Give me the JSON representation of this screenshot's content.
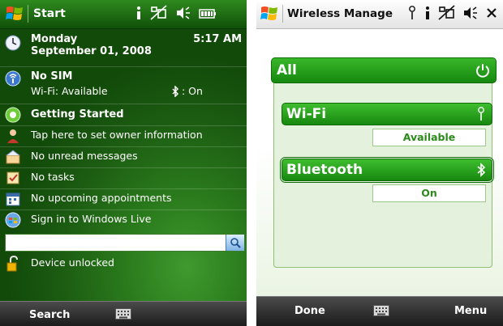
{
  "left_screen": {
    "titlebar": {
      "title": "Start"
    },
    "date_block": {
      "day": "Monday",
      "date": "September 01, 2008",
      "time": "5:17 AM"
    },
    "sim_block": {
      "title": "No SIM",
      "wifi": "Wi-Fi: Available",
      "bluetooth": ": On"
    },
    "items": [
      {
        "label": "Getting Started",
        "icon": "getting-started-icon"
      },
      {
        "label": "Tap here to set owner information",
        "icon": "owner-icon"
      },
      {
        "label": "No unread messages",
        "icon": "messages-icon"
      },
      {
        "label": "No tasks",
        "icon": "tasks-icon"
      },
      {
        "label": "No upcoming appointments",
        "icon": "calendar-icon"
      },
      {
        "label": "Sign in to Windows Live",
        "icon": "windows-live-icon"
      }
    ],
    "search": {
      "value": ""
    },
    "device_lock": {
      "label": "Device unlocked"
    },
    "softkeys": {
      "left": "Search"
    }
  },
  "right_screen": {
    "titlebar": {
      "title": "Wireless Manage"
    },
    "all": {
      "label": "All"
    },
    "radios": [
      {
        "label": "Wi-Fi",
        "status": "Available",
        "icon": "wifi-icon"
      },
      {
        "label": "Bluetooth",
        "status": "On",
        "icon": "bluetooth-icon"
      }
    ],
    "softkeys": {
      "left": "Done",
      "right": "Menu"
    }
  }
}
